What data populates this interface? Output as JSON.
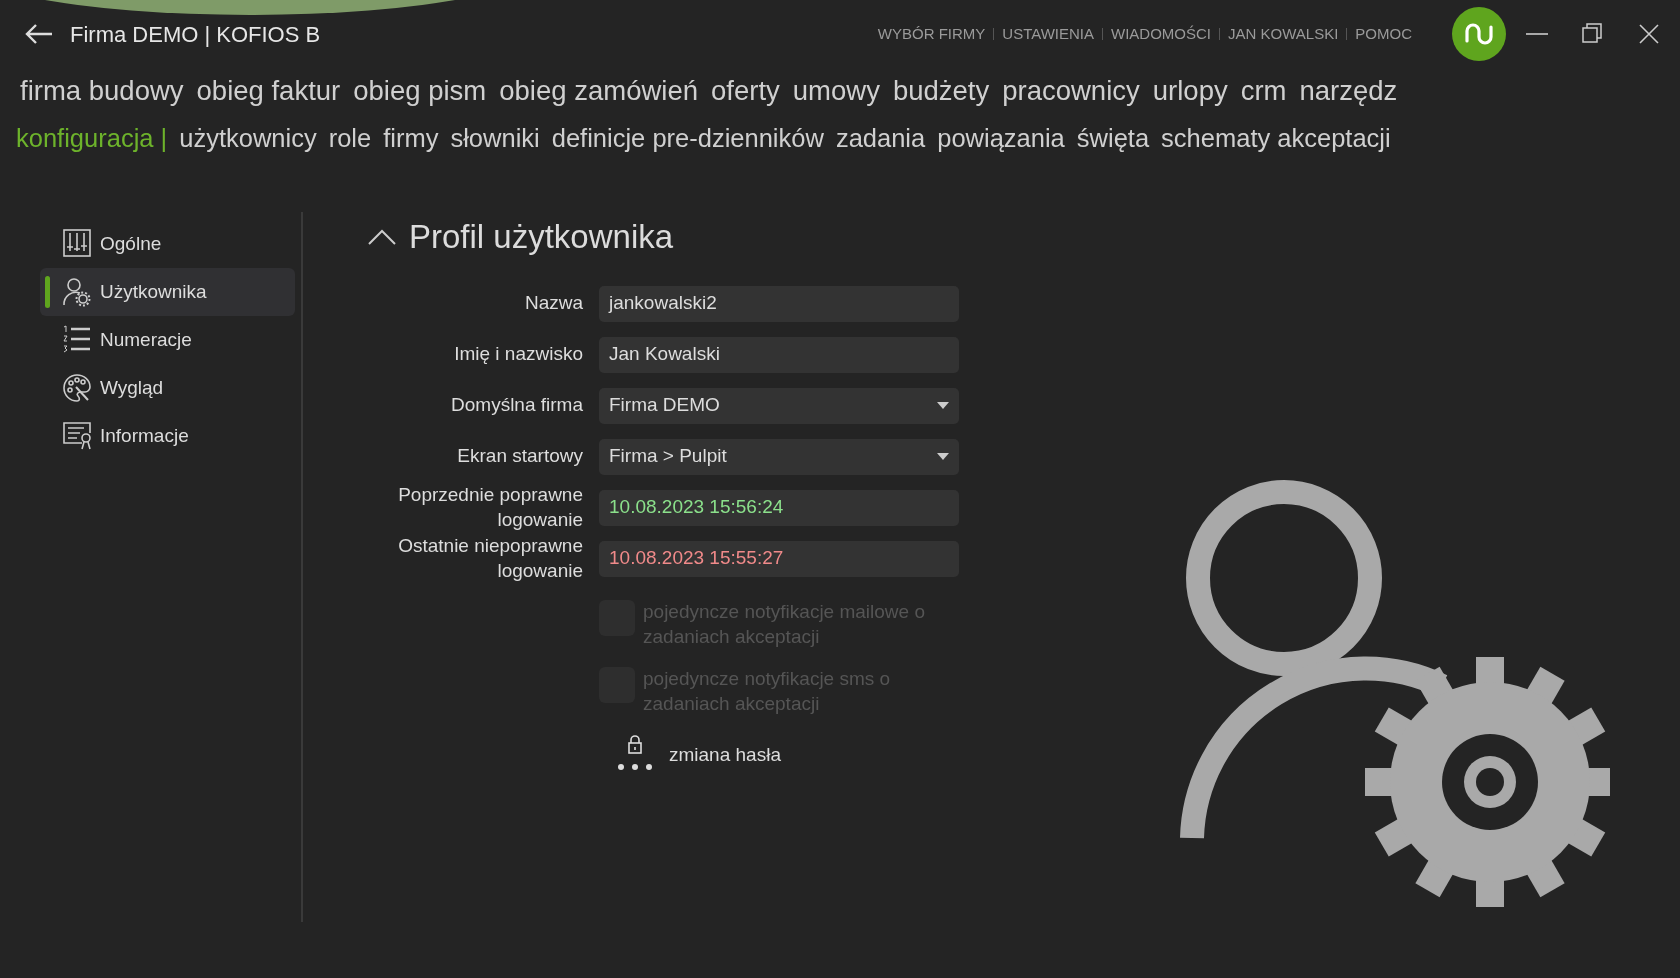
{
  "window": {
    "title": "Firma DEMO | KOFIOS B"
  },
  "top_menu": [
    "WYBÓR FIRMY",
    "USTAWIENIA",
    "WIADOMOŚCI",
    "JAN KOWALSKI",
    "POMOC"
  ],
  "main_nav": [
    {
      "label": "firma budowy",
      "selected": false
    },
    {
      "label": "obieg faktur",
      "selected": false
    },
    {
      "label": "obieg pism",
      "selected": false
    },
    {
      "label": "obieg zamówień",
      "selected": false
    },
    {
      "label": "oferty",
      "selected": false
    },
    {
      "label": "umowy",
      "selected": false
    },
    {
      "label": "budżety",
      "selected": false
    },
    {
      "label": "pracownicy",
      "selected": false
    },
    {
      "label": "urlopy",
      "selected": false
    },
    {
      "label": "crm",
      "selected": false
    },
    {
      "label": "narzędz",
      "selected": false
    }
  ],
  "sub_nav": {
    "section": "konfiguracja |",
    "items": [
      {
        "label": "użytkownicy",
        "selected": false
      },
      {
        "label": "role",
        "selected": false
      },
      {
        "label": "firmy",
        "selected": false
      },
      {
        "label": "słowniki",
        "selected": false
      },
      {
        "label": "definicje pre-dzienników",
        "selected": false
      },
      {
        "label": "zadania",
        "selected": false
      },
      {
        "label": "powiązania",
        "selected": false
      },
      {
        "label": "święta",
        "selected": false
      },
      {
        "label": "schematy akceptacji",
        "selected": false
      }
    ]
  },
  "sidebar": {
    "items": [
      {
        "label": "Ogólne",
        "kind": "sliders",
        "selected": false
      },
      {
        "label": "Użytkownika",
        "kind": "user-gear",
        "selected": true
      },
      {
        "label": "Numeracje",
        "kind": "numbered-list",
        "selected": false
      },
      {
        "label": "Wygląd",
        "kind": "palette",
        "selected": false
      },
      {
        "label": "Informacje",
        "kind": "certificate",
        "selected": false
      }
    ]
  },
  "profile": {
    "title": "Profil użytkownika",
    "expanded": true,
    "fields": [
      {
        "label": "Nazwa",
        "kind": "text",
        "value": "jankowalski2"
      },
      {
        "label": "Imię i nazwisko",
        "kind": "text",
        "value": "Jan Kowalski"
      },
      {
        "label": "Domyślna firma",
        "kind": "select",
        "value": "Firma DEMO"
      },
      {
        "label": "Ekran startowy",
        "kind": "select",
        "value": "Firma > Pulpit"
      },
      {
        "label": "Poprzednie poprawne logowanie",
        "kind": "success-time",
        "value": "10.08.2023 15:56:24"
      },
      {
        "label": "Ostatnie niepoprawne logowanie",
        "kind": "failure-time",
        "value": "10.08.2023 15:55:27"
      }
    ],
    "options": [
      {
        "label": "pojedyncze notyfikacje mailowe o zadaniach akceptacji",
        "checked": false,
        "disabled": true
      },
      {
        "label": "pojedyncze notyfikacje sms o zadaniach akceptacji",
        "checked": false,
        "disabled": true
      }
    ],
    "password_link": "zmiana hasła"
  }
}
